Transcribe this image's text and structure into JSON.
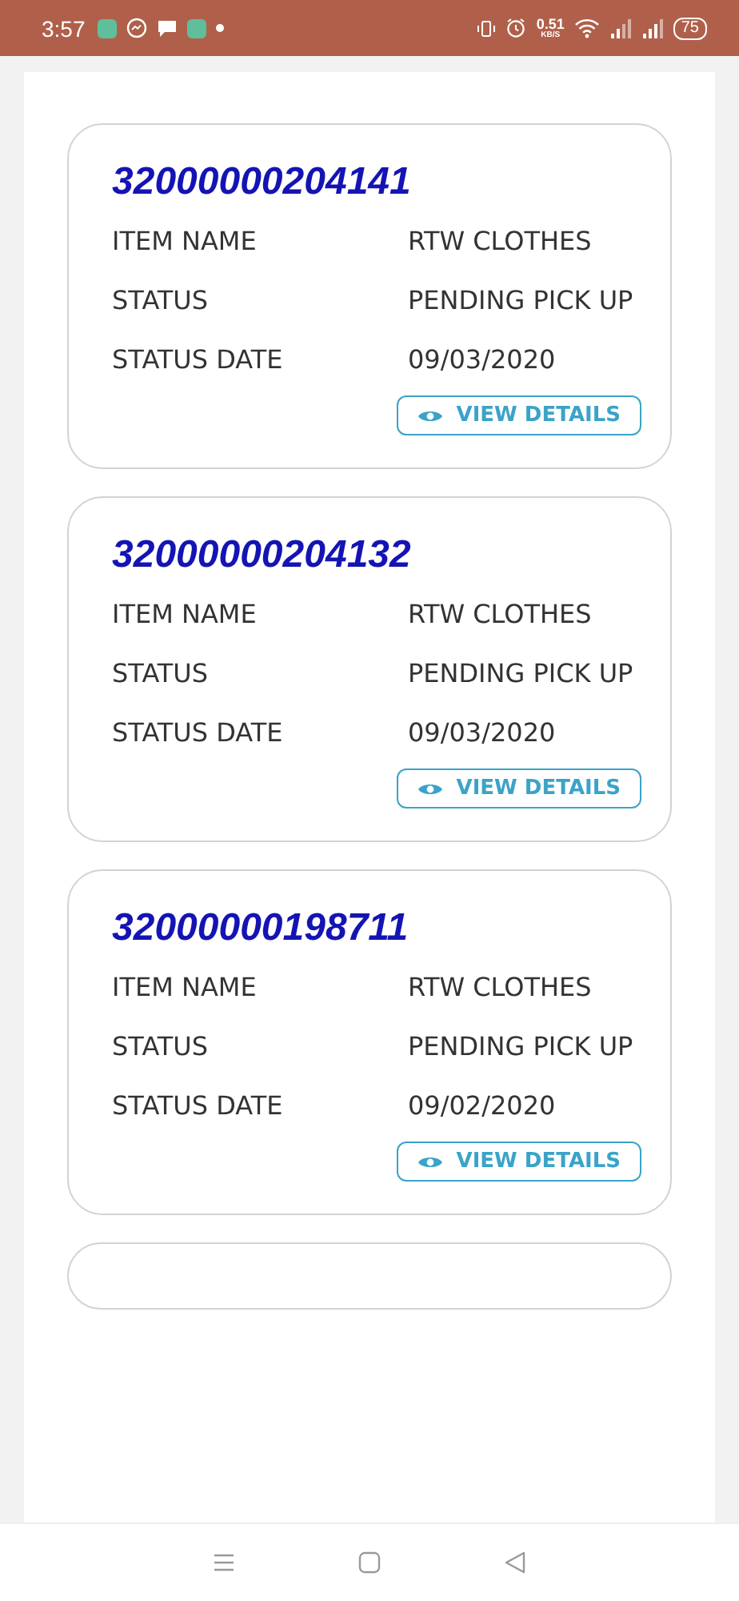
{
  "status_bar": {
    "time": "3:57",
    "speed": "0.51",
    "speed_unit": "KB/S",
    "battery": "75"
  },
  "shipments": [
    {
      "tracking_number": "32000000204141",
      "fields": [
        {
          "label": "ITEM NAME",
          "value": "RTW CLOTHES"
        },
        {
          "label": "STATUS",
          "value": "PENDING PICK UP"
        },
        {
          "label": "STATUS DATE",
          "value": "09/03/2020"
        }
      ],
      "button": "VIEW DETAILS"
    },
    {
      "tracking_number": "32000000204132",
      "fields": [
        {
          "label": "ITEM NAME",
          "value": "RTW CLOTHES"
        },
        {
          "label": "STATUS",
          "value": "PENDING PICK UP"
        },
        {
          "label": "STATUS DATE",
          "value": "09/03/2020"
        }
      ],
      "button": "VIEW DETAILS"
    },
    {
      "tracking_number": "32000000198711",
      "fields": [
        {
          "label": "ITEM NAME",
          "value": "RTW CLOTHES"
        },
        {
          "label": "STATUS",
          "value": "PENDING PICK UP"
        },
        {
          "label": "STATUS DATE",
          "value": "09/02/2020"
        }
      ],
      "button": "VIEW DETAILS"
    }
  ]
}
